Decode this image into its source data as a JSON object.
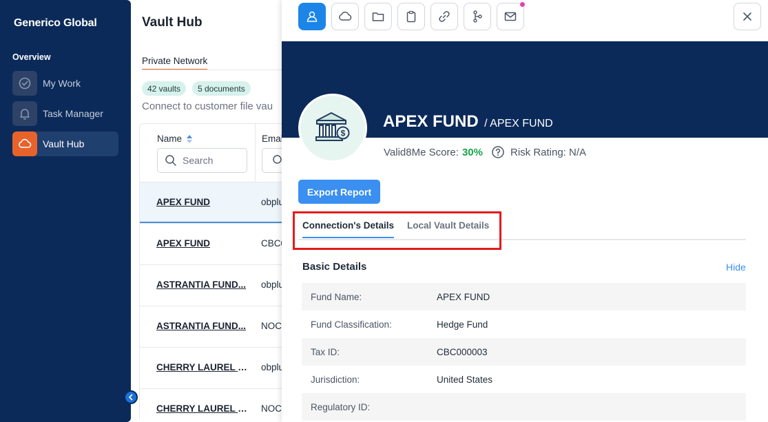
{
  "sidebar": {
    "brand": "Generico Global",
    "section": "Overview",
    "items": [
      {
        "label": "My Work",
        "icon": "check-circle-icon"
      },
      {
        "label": "Task Manager",
        "icon": "bell-icon"
      },
      {
        "label": "Vault Hub",
        "icon": "cloud-icon",
        "active": true
      }
    ]
  },
  "main": {
    "title": "Vault Hub",
    "tab": "Private Network",
    "badges": [
      "42 vaults",
      "5 documents"
    ],
    "description": "Connect to customer file vau",
    "table": {
      "headers": {
        "name": "Name",
        "email": "Emai"
      },
      "search_placeholder": "Search",
      "rows": [
        {
          "name": "APEX FUND",
          "email": "obplu"
        },
        {
          "name": "APEX FUND",
          "email": "CBC0"
        },
        {
          "name": "ASTRANTIA FUND...",
          "email": "obplu"
        },
        {
          "name": "ASTRANTIA FUND...",
          "email": "NOC"
        },
        {
          "name": "CHERRY LAUREL F...",
          "email": "obplu"
        },
        {
          "name": "CHERRY LAUREL F...",
          "email": "NOC"
        }
      ]
    }
  },
  "drawer": {
    "toolbar_icons": [
      "user-icon",
      "cloud-icon",
      "folder-icon",
      "clipboard-icon",
      "link-icon",
      "branch-icon",
      "mail-icon"
    ],
    "fund_name": "APEX FUND",
    "fund_subtitle": "/ APEX FUND",
    "score_label": "Valid8Me Score:",
    "score_value": "30%",
    "risk_label": "Risk Rating: N/A",
    "export_label": "Export Report",
    "tabs": [
      "Connection's Details",
      "Local Vault Details"
    ],
    "section_title": "Basic Details",
    "hide_label": "Hide",
    "details": [
      {
        "label": "Fund Name:",
        "value": "APEX FUND"
      },
      {
        "label": "Fund Classification:",
        "value": "Hedge Fund"
      },
      {
        "label": "Tax ID:",
        "value": "CBC000003"
      },
      {
        "label": "Jurisdiction:",
        "value": "United States"
      },
      {
        "label": "Regulatory ID:",
        "value": ""
      }
    ]
  },
  "colors": {
    "sidebar_bg": "#0b2a59",
    "accent_orange": "#e8632b",
    "primary_blue": "#3a8ff0",
    "score_green": "#16a34a",
    "highlight_red": "#e41b1b"
  }
}
